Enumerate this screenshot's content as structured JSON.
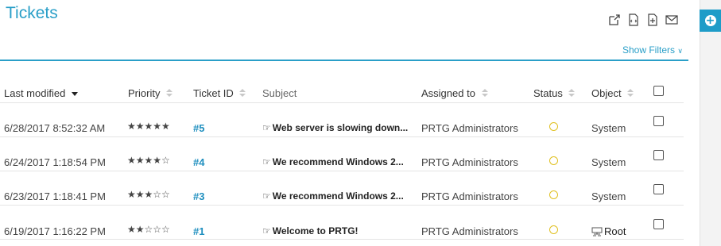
{
  "page": {
    "title": "Tickets",
    "show_filters": "Show Filters",
    "chevron": "∨"
  },
  "toolbar": {
    "icons": [
      "external-link-icon",
      "xml-icon",
      "export-file-icon",
      "mail-icon"
    ]
  },
  "columns": {
    "last_modified": "Last modified",
    "priority": "Priority",
    "ticket_id": "Ticket ID",
    "subject": "Subject",
    "assigned_to": "Assigned to",
    "status": "Status",
    "object": "Object"
  },
  "rows": [
    {
      "last_modified": "6/28/2017 8:52:32 AM",
      "priority_stars": "★★★★★",
      "priority": 5,
      "ticket_id": "#5",
      "subject": "Web server is slowing down...",
      "assigned_to": "PRTG Administrators",
      "object": "System"
    },
    {
      "last_modified": "6/24/2017 1:18:54 PM",
      "priority_stars": "★★★★☆",
      "priority": 4,
      "ticket_id": "#4",
      "subject": "We recommend Windows 2...",
      "assigned_to": "PRTG Administrators",
      "object": "System"
    },
    {
      "last_modified": "6/23/2017 1:18:41 PM",
      "priority_stars": "★★★☆☆",
      "priority": 3,
      "ticket_id": "#3",
      "subject": "We recommend Windows 2...",
      "assigned_to": "PRTG Administrators",
      "object": "System"
    },
    {
      "last_modified": "6/19/2017 1:16:22 PM",
      "priority_stars": "★★☆☆☆",
      "priority": 2,
      "ticket_id": "#1",
      "subject": "Welcome to PRTG!",
      "assigned_to": "PRTG Administrators",
      "object": "Root"
    }
  ],
  "colors": {
    "accent": "#2a9fc8",
    "status_open": "#e0c020"
  }
}
